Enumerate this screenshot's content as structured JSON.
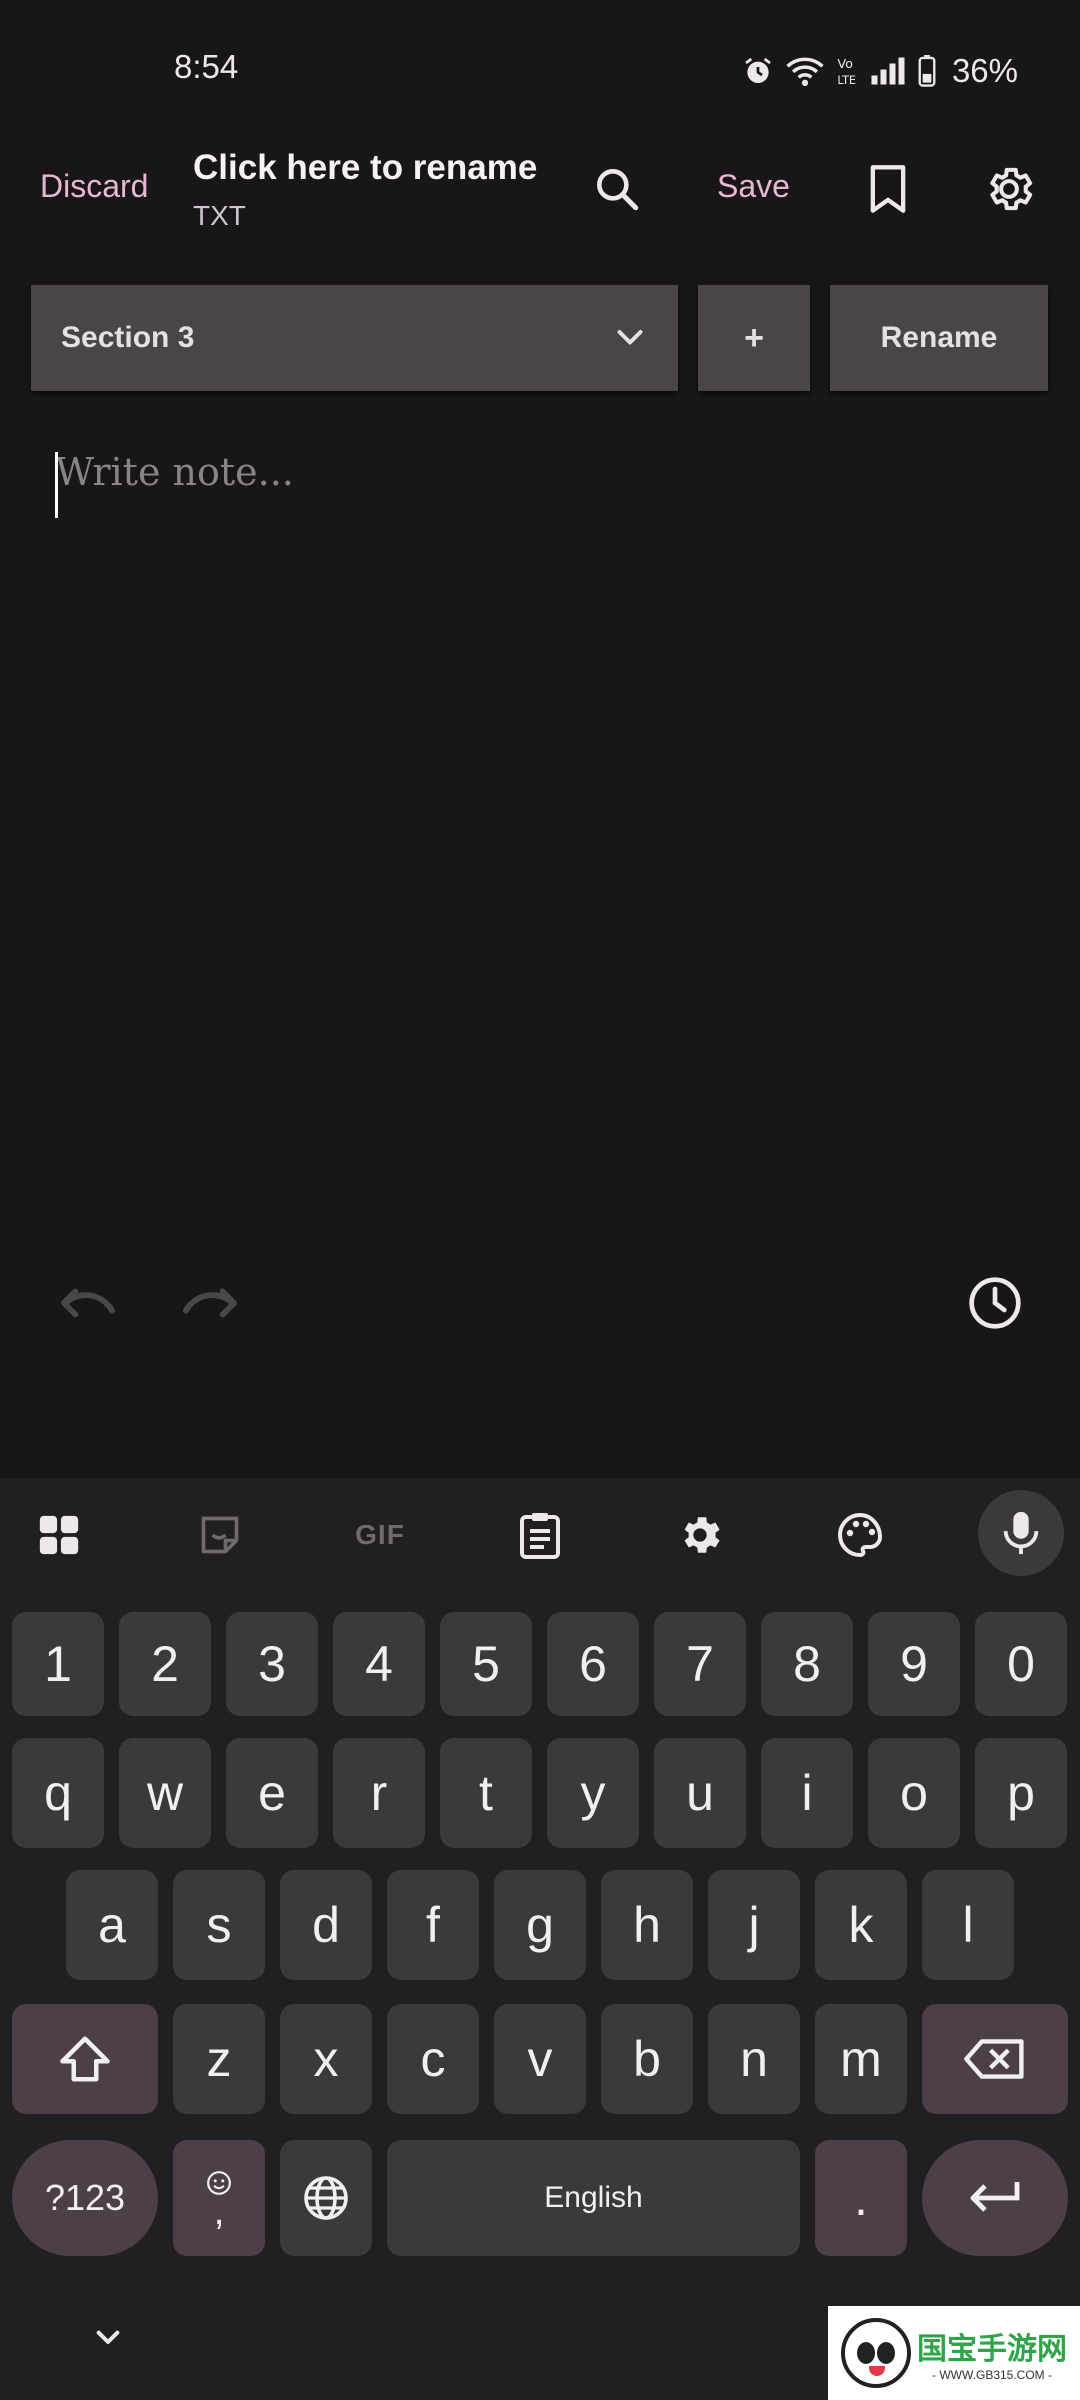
{
  "status_bar": {
    "time": "8:54",
    "battery": "36%",
    "icons": [
      "alarm-icon",
      "wifi-icon",
      "volte-icon",
      "signal-icon",
      "battery-icon"
    ]
  },
  "header": {
    "discard_label": "Discard",
    "title": "Click here to rename",
    "subtitle": "TXT",
    "save_label": "Save",
    "icons": [
      "search-icon",
      "bookmark-icon",
      "settings-icon"
    ]
  },
  "sections": {
    "selected": "Section 3",
    "add_label": "+",
    "rename_label": "Rename"
  },
  "editor": {
    "placeholder": "Write note...",
    "value": ""
  },
  "editor_tools": {
    "icons": [
      "undo-icon",
      "redo-icon",
      "history-icon"
    ]
  },
  "keyboard": {
    "toolbar_icons": [
      "apps-grid-icon",
      "sticker-icon",
      "gif-icon",
      "clipboard-icon",
      "settings-icon",
      "palette-icon",
      "mic-icon"
    ],
    "gif_label": "GIF",
    "row_numbers": [
      "1",
      "2",
      "3",
      "4",
      "5",
      "6",
      "7",
      "8",
      "9",
      "0"
    ],
    "row1": [
      "q",
      "w",
      "e",
      "r",
      "t",
      "y",
      "u",
      "i",
      "o",
      "p"
    ],
    "row2": [
      "a",
      "s",
      "d",
      "f",
      "g",
      "h",
      "j",
      "k",
      "l"
    ],
    "row3": [
      "z",
      "x",
      "c",
      "v",
      "b",
      "n",
      "m"
    ],
    "symbols_label": "?123",
    "comma_label": ",",
    "space_label": "English",
    "period_label": ".",
    "accent_color": "#4d3f48"
  },
  "watermark": {
    "title": "国宝手游网",
    "url": "- WWW.GB315.COM -"
  }
}
